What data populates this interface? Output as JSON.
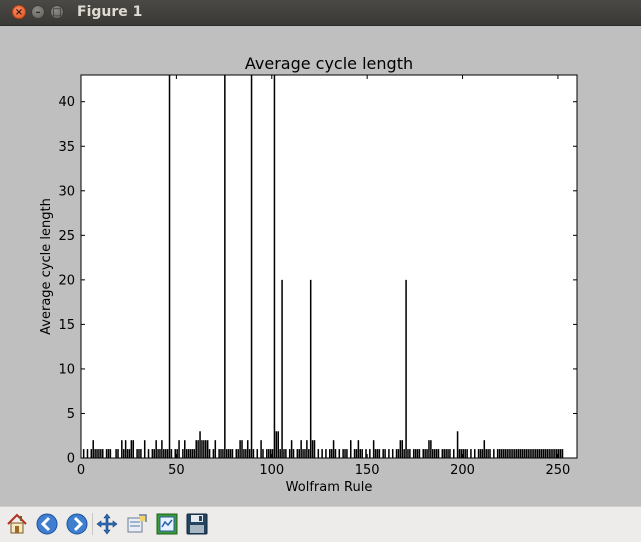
{
  "window": {
    "title": "Figure 1",
    "buttons": {
      "close": "×",
      "minimize": "–",
      "maximize": "□"
    }
  },
  "toolbar": {
    "buttons": [
      {
        "icon": "home-icon"
      },
      {
        "icon": "back-arrow-icon"
      },
      {
        "icon": "forward-arrow-icon"
      },
      {
        "icon": "pan-icon"
      },
      {
        "icon": "zoom-icon"
      },
      {
        "icon": "subplots-icon"
      },
      {
        "icon": "save-icon"
      }
    ]
  },
  "chart_data": {
    "type": "bar",
    "title": "Average cycle length",
    "xlabel": "Wolfram Rule",
    "ylabel": "Average cycle length",
    "xlim": [
      0,
      260
    ],
    "ylim": [
      0,
      43
    ],
    "xticks": [
      0,
      50,
      100,
      150,
      200,
      250
    ],
    "yticks": [
      0,
      5,
      10,
      15,
      20,
      25,
      30,
      35,
      40
    ],
    "grid": false,
    "bar_color": "#000000",
    "x": [
      1,
      3,
      5,
      6,
      7,
      8,
      9,
      10,
      11,
      13,
      14,
      15,
      18,
      19,
      21,
      22,
      23,
      24,
      25,
      26,
      27,
      29,
      30,
      31,
      33,
      35,
      37,
      38,
      39,
      40,
      41,
      42,
      43,
      44,
      45,
      46,
      47,
      49,
      50,
      51,
      53,
      54,
      55,
      56,
      57,
      58,
      59,
      60,
      61,
      62,
      63,
      64,
      65,
      66,
      67,
      69,
      70,
      72,
      73,
      74,
      75,
      76,
      77,
      78,
      79,
      81,
      82,
      83,
      84,
      85,
      86,
      87,
      88,
      89,
      90,
      92,
      94,
      95,
      97,
      98,
      99,
      100,
      101,
      102,
      103,
      104,
      105,
      106,
      107,
      109,
      110,
      111,
      113,
      114,
      115,
      116,
      117,
      118,
      119,
      120,
      121,
      122,
      124,
      126,
      128,
      130,
      131,
      132,
      133,
      135,
      137,
      138,
      139,
      141,
      143,
      144,
      145,
      146,
      147,
      149,
      151,
      153,
      154,
      155,
      156,
      158,
      159,
      161,
      163,
      165,
      166,
      167,
      168,
      169,
      170,
      171,
      172,
      174,
      175,
      176,
      177,
      179,
      180,
      181,
      182,
      183,
      184,
      185,
      186,
      187,
      189,
      190,
      191,
      192,
      193,
      195,
      197,
      198,
      199,
      200,
      201,
      202,
      204,
      206,
      208,
      209,
      210,
      211,
      212,
      213,
      214,
      216,
      218,
      219,
      220,
      221,
      222,
      223,
      224,
      225,
      226,
      227,
      228,
      229,
      230,
      231,
      232,
      233,
      234,
      235,
      236,
      237,
      238,
      239,
      240,
      241,
      242,
      243,
      244,
      245,
      246,
      247,
      248,
      249,
      250,
      251,
      252,
      253,
      254,
      255
    ],
    "values": [
      1,
      1,
      1,
      2,
      1,
      1,
      1,
      1,
      1,
      1,
      1,
      1,
      1,
      1,
      2,
      1,
      2,
      1,
      1,
      2,
      2,
      1,
      1,
      1,
      2,
      1,
      1,
      1,
      2,
      1,
      1,
      2,
      1,
      1,
      1,
      43,
      1,
      1,
      1,
      2,
      1,
      2,
      1,
      1,
      1,
      1,
      1,
      2,
      2,
      3,
      2,
      2,
      2,
      2,
      1,
      1,
      2,
      1,
      1,
      1,
      43,
      1,
      1,
      1,
      1,
      1,
      1,
      2,
      2,
      1,
      1,
      2,
      1,
      43,
      1,
      1,
      2,
      1,
      1,
      1,
      1,
      1,
      43,
      3,
      3,
      1,
      20,
      1,
      1,
      1,
      2,
      1,
      1,
      1,
      2,
      1,
      1,
      2,
      1,
      20,
      2,
      2,
      1,
      1,
      1,
      1,
      1,
      2,
      1,
      1,
      1,
      1,
      1,
      2,
      1,
      1,
      2,
      1,
      1,
      1,
      1,
      2,
      1,
      1,
      1,
      1,
      1,
      1,
      1,
      1,
      1,
      2,
      2,
      1,
      20,
      1,
      1,
      1,
      1,
      1,
      1,
      1,
      1,
      1,
      2,
      2,
      1,
      1,
      1,
      1,
      1,
      1,
      1,
      1,
      1,
      1,
      3,
      1,
      1,
      1,
      1,
      1,
      1,
      1,
      1,
      1,
      1,
      2,
      1,
      1,
      1,
      1,
      1,
      1,
      1,
      1,
      1,
      1,
      1,
      1,
      1,
      1,
      1,
      1,
      1,
      1,
      1,
      1,
      1,
      1,
      1,
      1,
      1,
      1,
      1,
      1,
      1,
      1,
      1,
      1,
      1,
      1,
      1,
      1,
      1,
      1,
      1
    ]
  }
}
